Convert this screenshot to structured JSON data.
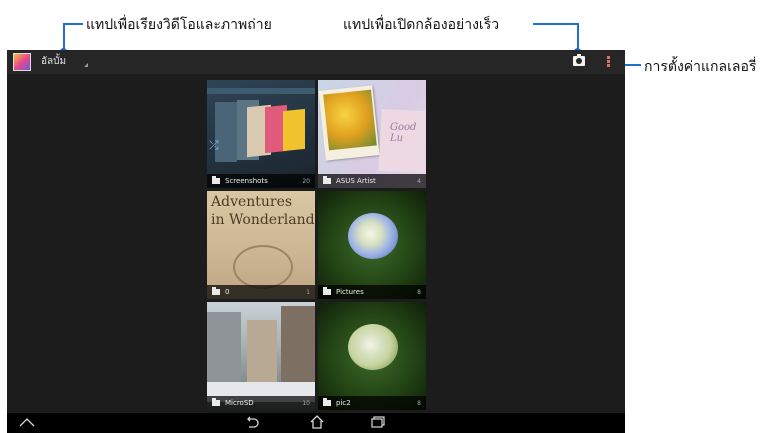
{
  "callouts": {
    "sort_text": "แทปเพื่อเรียงวิดีโอและภาพถ่าย",
    "camera_text": "แทปเพื่อเปิดกล้องอย่างเร็ว",
    "settings_text": "การตั้งค่าแกลเลอรี่"
  },
  "actionbar": {
    "app_icon": "gallery-icon",
    "album_label": "อัลบั้ม",
    "camera_icon": "camera-icon",
    "menu_icon": "overflow-menu-icon"
  },
  "albums": [
    {
      "name": "Screenshots",
      "count": "20"
    },
    {
      "name": "ASUS Artist",
      "count": "4"
    },
    {
      "name": "0",
      "count": "1",
      "thumb_text": "Adventures\nin Wonderland"
    },
    {
      "name": "Pictures",
      "count": "8"
    },
    {
      "name": "MicroSD",
      "count": "10"
    },
    {
      "name": "pic2",
      "count": "8"
    }
  ],
  "asus_thumb_text": "Good Lu",
  "navbar": {
    "up_icon": "chevron-up-icon",
    "back_icon": "back-icon",
    "home_icon": "home-icon",
    "recents_icon": "recents-icon"
  },
  "colors": {
    "callout_line": "#1f6fd1",
    "screen_bg": "#1c1c1c",
    "actionbar_bg": "#262626"
  }
}
